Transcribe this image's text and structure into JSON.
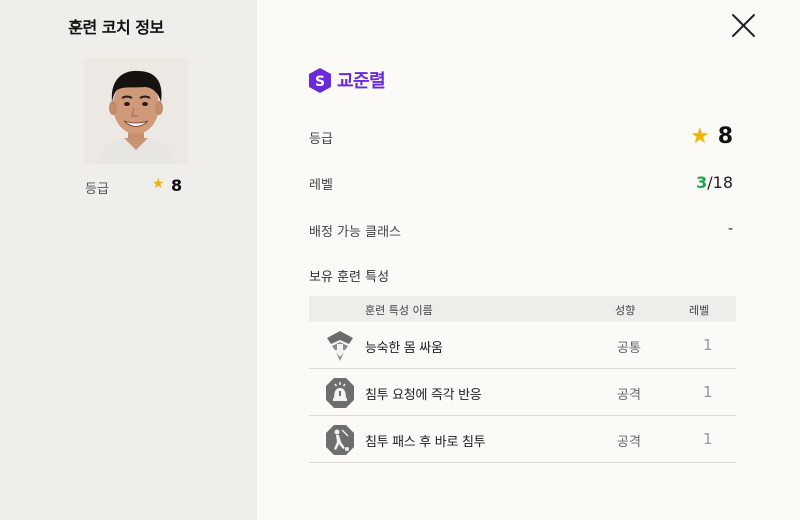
{
  "left": {
    "title": "훈련 코치 정보",
    "grade_label": "등급",
    "grade_value": "8"
  },
  "coach": {
    "badge": "S",
    "name": "교준렬"
  },
  "info": {
    "grade_label": "등급",
    "grade_value": "8",
    "level_label": "레벨",
    "level_current": "3",
    "level_max": "/18",
    "class_label": "배정 가능 클래스",
    "class_value": "-"
  },
  "traits": {
    "section_title": "보유 훈련 특성",
    "headers": {
      "name": "훈련 특성 이름",
      "type": "성향",
      "level": "레벨"
    },
    "rows": [
      {
        "icon": "shield-down-arrow-icon",
        "name": "능숙한 몸 싸움",
        "type": "공통",
        "level": "1"
      },
      {
        "icon": "octagon-alert-icon",
        "name": "침투 요청에 즉각 반응",
        "type": "공격",
        "level": "1"
      },
      {
        "icon": "octagon-pass-icon",
        "name": "침투 패스 후 바로 침투",
        "type": "공격",
        "level": "1"
      }
    ]
  },
  "colors": {
    "accent_purple": "#6a2ad9",
    "star_gold": "#f0b400",
    "level_green": "#1fa84a",
    "left_panel_bg": "#efeeea"
  }
}
